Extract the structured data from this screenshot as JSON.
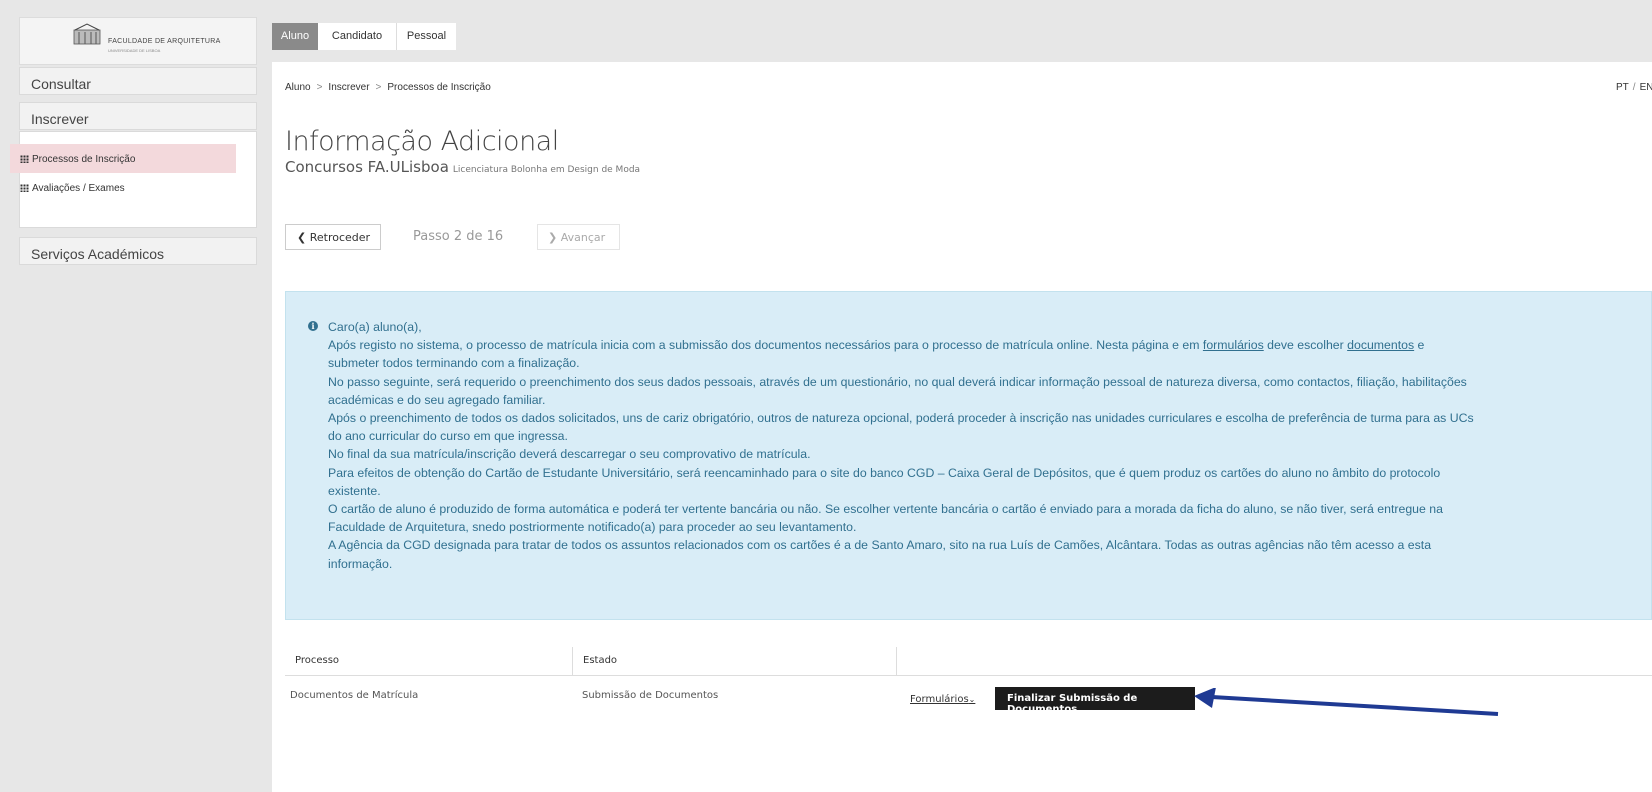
{
  "logo": {
    "text": "FACULDADE DE ARQUITETURA",
    "sub": "UNIVERSIDADE DE LISBOA"
  },
  "sidebar": {
    "consultar": "Consultar",
    "inscrever": "Inscrever",
    "items": [
      {
        "label": "Processos de Inscrição",
        "active": true
      },
      {
        "label": "Avaliações / Exames",
        "active": false
      }
    ],
    "servicos": "Serviços Académicos"
  },
  "tabs": [
    "Aluno",
    "Candidato",
    "Pessoal"
  ],
  "breadcrumb": [
    "Aluno",
    "Inscrever",
    "Processos de Inscrição"
  ],
  "breadcrumb_sep": ">",
  "lang": {
    "pt": "PT",
    "sep": "/",
    "en": "EN"
  },
  "page": {
    "title": "Informação Adicional",
    "subtitle": "Concursos FA.ULisboa",
    "subtitle_small": "Licenciatura Bolonha em Design de Moda"
  },
  "stepper": {
    "back": "Retroceder",
    "step": "Passo 2 de 16",
    "next": "Avançar"
  },
  "alert": {
    "line1": "Caro(a) aluno(a),",
    "line2a": "Após registo no sistema, o processo de matrícula inicia com a submissão dos documentos necessários para o processo de matrícula online. Nesta página e em ",
    "link1": "formulários",
    "line2b": " deve escolher ",
    "link2": "documentos",
    "line2c": " e",
    "line3": "submeter todos terminando com a finalização.",
    "line4": "No passo seguinte, será requerido o preenchimento dos seus dados pessoais, através de um questionário, no qual deverá indicar informação pessoal de natureza diversa, como contactos, filiação, habilitações",
    "line5": "académicas e do seu agregado familiar.",
    "line6": "Após o preenchimento de todos os dados solicitados, uns de cariz obrigatório, outros de natureza opcional, poderá proceder à inscrição nas unidades curriculares e escolha de preferência de turma para as UCs",
    "line7": "do ano curricular do curso em que ingressa.",
    "line8": "No final da sua matrícula/inscrição deverá descarregar o seu comprovativo de matrícula.",
    "line9": "Para efeitos de obtenção do Cartão de Estudante Universitário, será reencaminhado para o site do banco CGD – Caixa Geral de Depósitos, que é quem produz os cartões do aluno no âmbito do protocolo",
    "line10": "existente.",
    "line11": "O cartão de aluno é produzido de forma automática e poderá ter vertente bancária ou não. Se escolher vertente bancária o cartão é enviado para a morada da ficha do aluno, se não tiver, será entregue na",
    "line12": "Faculdade de Arquitetura, snedo postriormente notificado(a) para proceder ao seu levantamento.",
    "line13": "A Agência da CGD designada para tratar de todos os assuntos relacionados com os cartões é a de Santo Amaro, sito na rua Luís de Camões, Alcântara. Todas as outras agências não têm acesso a esta",
    "line14": "informação."
  },
  "table": {
    "headers": [
      "Processo",
      "Estado"
    ],
    "row": {
      "processo": "Documentos de Matrícula",
      "estado": "Submissão de Documentos"
    },
    "formularios": "Formulários",
    "finalizar": "Finalizar Submissão de Documentos"
  },
  "colors": {
    "accent_active": "#f3d9dc",
    "alert_bg": "#d9edf7",
    "alert_text": "#31708f",
    "arrow": "#1f3a93"
  }
}
